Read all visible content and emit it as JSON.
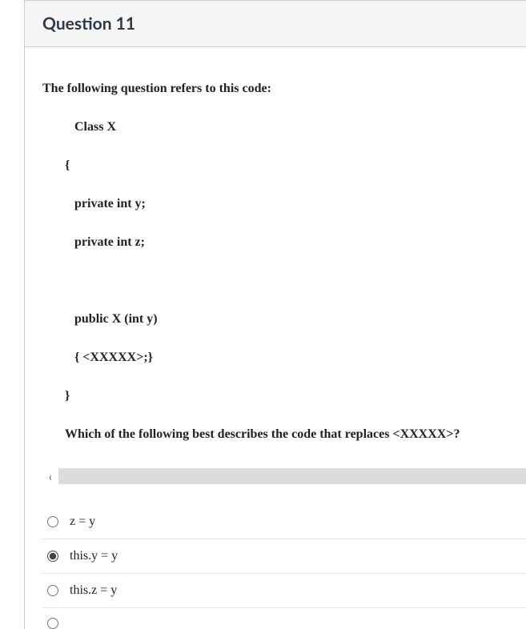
{
  "header": {
    "title": "Question 11"
  },
  "stem": {
    "intro": "The following question refers to this code:",
    "lines": [
      {
        "cls": "ind2",
        "text": "Class X"
      },
      {
        "cls": "ind1",
        "text": "{"
      },
      {
        "cls": "ind2",
        "text": "private int y;"
      },
      {
        "cls": "ind2",
        "text": "private int z;"
      },
      {
        "cls": "ind2",
        "text": " "
      },
      {
        "cls": "ind2",
        "text": "public X (int y)"
      },
      {
        "cls": "ind2",
        "text": "{  <XXXXX>;}"
      },
      {
        "cls": "ind1",
        "text": "}"
      }
    ],
    "prompt": "Which of the following best describes the code that replaces <XXXXX>?"
  },
  "scroll": {
    "left_glyph": "‹"
  },
  "answers": [
    {
      "text": "z = y",
      "selected": false
    },
    {
      "text": "this.y = y",
      "selected": true
    },
    {
      "text": "this.z = y",
      "selected": false
    },
    {
      "text": "",
      "selected": false,
      "partial": true
    }
  ]
}
